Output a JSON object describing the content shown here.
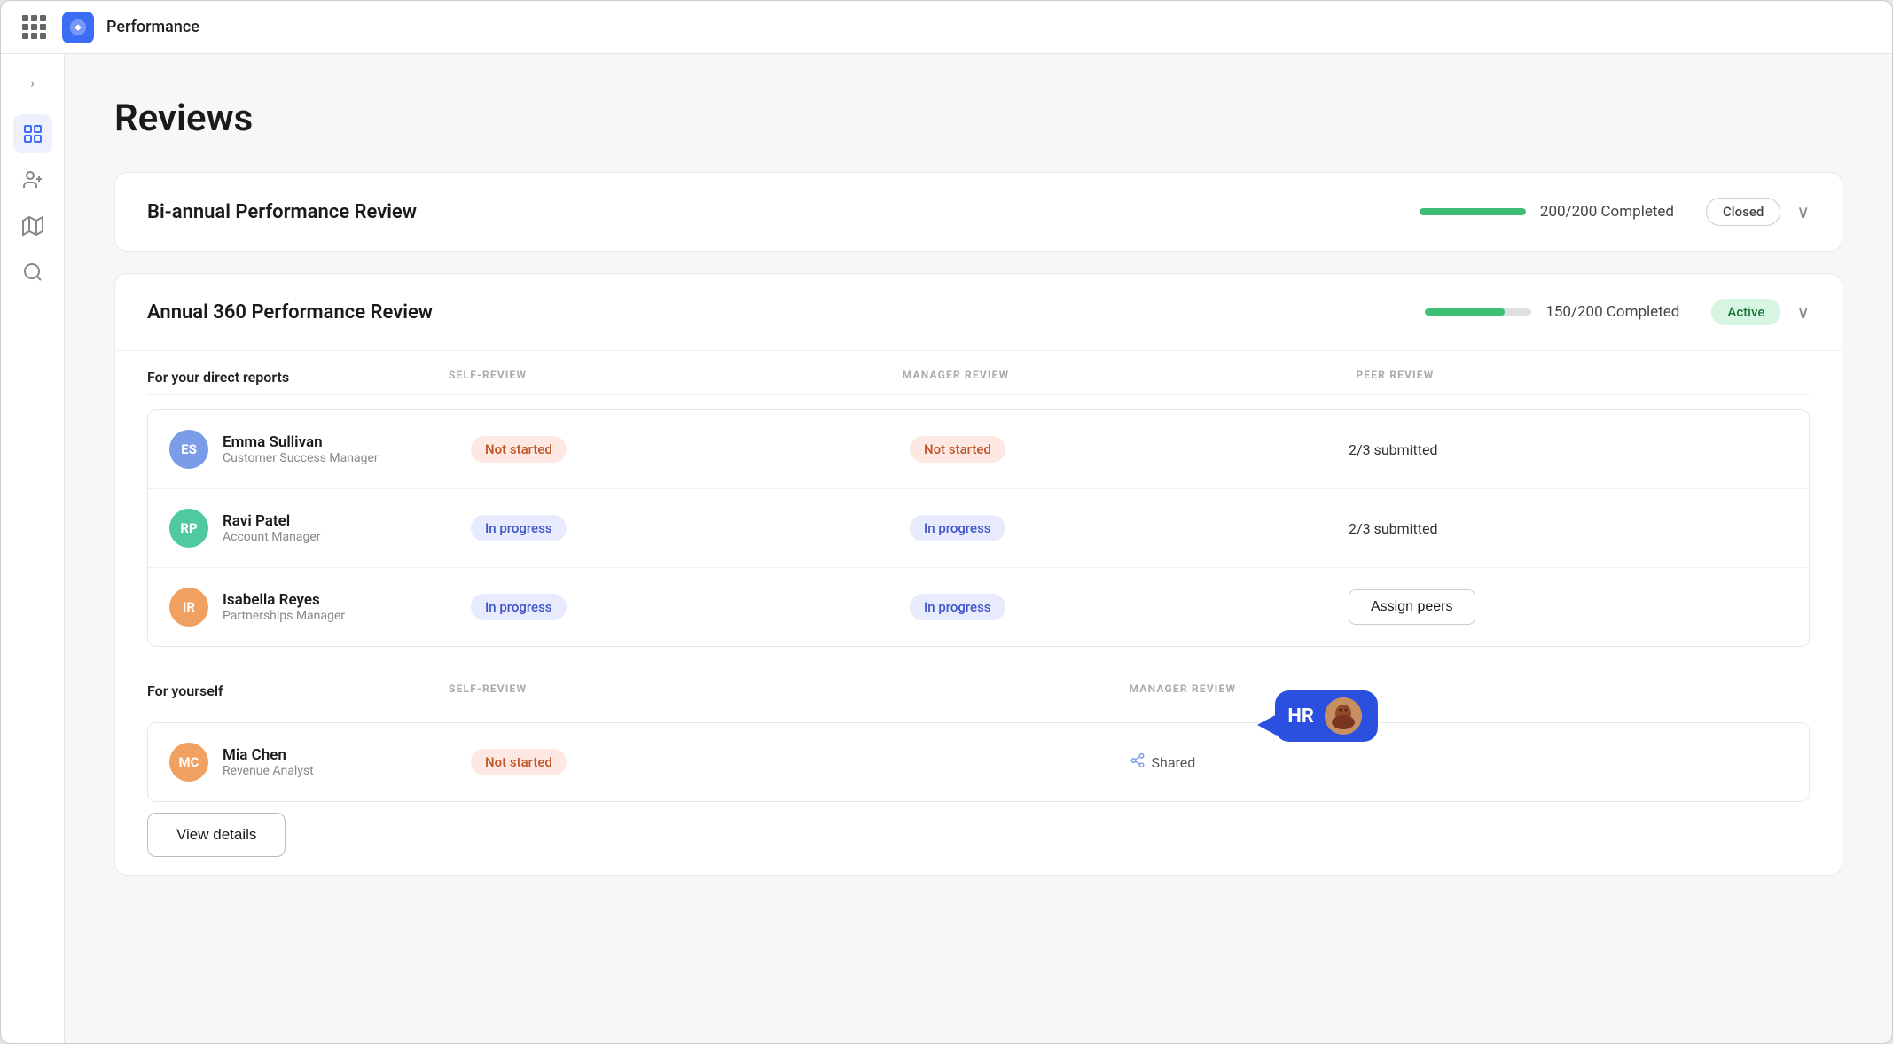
{
  "app": {
    "title": "Performance",
    "grid_dots": 9
  },
  "sidebar": {
    "toggle_label": "›",
    "items": [
      {
        "name": "grid",
        "icon": "grid"
      },
      {
        "name": "users",
        "icon": "users"
      },
      {
        "name": "map",
        "icon": "map"
      },
      {
        "name": "search",
        "icon": "search"
      }
    ]
  },
  "page": {
    "title": "Reviews"
  },
  "reviews": [
    {
      "id": "biannual",
      "title": "Bi-annual Performance Review",
      "progress_value": 100,
      "progress_label": "200/200 Completed",
      "status": "Closed",
      "status_type": "closed",
      "expanded": false
    },
    {
      "id": "annual360",
      "title": "Annual 360 Performance Review",
      "progress_value": 75,
      "progress_label": "150/200 Completed",
      "status": "Active",
      "status_type": "active",
      "expanded": true,
      "sections": {
        "direct_reports": {
          "label": "For your direct reports",
          "col_self_review": "SELF-REVIEW",
          "col_manager_review": "MANAGER REVIEW",
          "col_peer_review": "PEER REVIEW",
          "people": [
            {
              "initials": "ES",
              "name": "Emma Sullivan",
              "role": "Customer Success Manager",
              "self_review": "Not started",
              "self_review_type": "not-started",
              "manager_review": "Not started",
              "manager_review_type": "not-started",
              "peer_review": "2/3 submitted",
              "peer_review_type": "text"
            },
            {
              "initials": "RP",
              "name": "Ravi Patel",
              "role": "Account Manager",
              "self_review": "In progress",
              "self_review_type": "in-progress",
              "manager_review": "In progress",
              "manager_review_type": "in-progress",
              "peer_review": "2/3 submitted",
              "peer_review_type": "text"
            },
            {
              "initials": "IR",
              "name": "Isabella Reyes",
              "role": "Partnerships Manager",
              "self_review": "In progress",
              "self_review_type": "in-progress",
              "manager_review": "In progress",
              "manager_review_type": "in-progress",
              "peer_review": "Assign peers",
              "peer_review_type": "button"
            }
          ]
        },
        "for_yourself": {
          "label": "For yourself",
          "col_self_review": "SELF-REVIEW",
          "col_manager_review": "MANAGER REVIEW",
          "people": [
            {
              "initials": "MC",
              "name": "Mia Chen",
              "role": "Revenue Analyst",
              "self_review": "Not started",
              "self_review_type": "not-started",
              "manager_review": "Shared",
              "manager_review_type": "shared"
            }
          ]
        }
      }
    }
  ],
  "buttons": {
    "view_details": "View details",
    "assign_peers": "Assign peers"
  },
  "hr_overlay": {
    "label": "HR"
  }
}
